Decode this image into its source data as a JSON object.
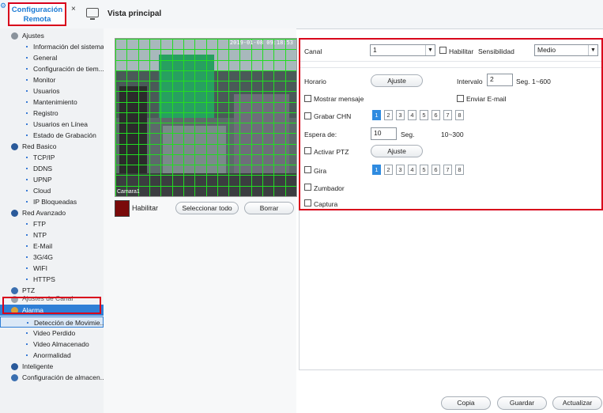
{
  "tabs": {
    "config_label": "Configuración Remota",
    "close_glyph": "×",
    "vista_label": "Vista principal"
  },
  "sidebar": {
    "groups": [
      {
        "label": "Ajustes",
        "icon": "gear-icon"
      },
      {
        "label": "Red Basico",
        "icon": "globe-icon"
      },
      {
        "label": "Red Avanzado",
        "icon": "globe-icon"
      },
      {
        "label": "PTZ",
        "icon": "ptz-icon"
      },
      {
        "label": "Ajustes de Canal",
        "icon": "channel-icon"
      },
      {
        "label": "Alarma",
        "icon": "alarm-icon"
      },
      {
        "label": "Inteligente",
        "icon": "info-icon"
      },
      {
        "label": "Configuración de almacen...",
        "icon": "storage-icon"
      }
    ],
    "ajustes_items": [
      "Información del sistema",
      "General",
      "Configuración de tiem...",
      "Monitor",
      "Usuarios",
      "Mantenimiento",
      "Registro",
      "Usuarios en Línea",
      "Estado de Grabación"
    ],
    "red_basico_items": [
      "TCP/IP",
      "DDNS",
      "UPNP",
      "Cloud",
      "IP Bloqueadas"
    ],
    "red_avanzado_items": [
      "FTP",
      "NTP",
      "E-Mail",
      "3G/4G",
      "WIFI",
      "HTTPS"
    ],
    "alarma_items": [
      "Detección de Movimie...",
      "Video Perdido",
      "Video Almacenado",
      "Anormalidad"
    ]
  },
  "preview": {
    "timestamp": "2019-01-08 09:18:53",
    "camera_name": "Camara1",
    "habilitar_label": "Habilitar",
    "select_all_label": "Seleccionar todo",
    "clear_label": "Borrar",
    "swatch_color": "#7a0a0a",
    "grid_color": "#22dd22"
  },
  "settings": {
    "canal_label": "Canal",
    "canal_value": "1",
    "habilitar_label": "Habilitar",
    "sensibilidad_label": "Sensibilidad",
    "sensibilidad_value": "Medio",
    "horario_label": "Horario",
    "ajuste_label": "Ajuste",
    "intervalo_label": "Intervalo",
    "intervalo_value": "2",
    "intervalo_unit": "Seg.",
    "intervalo_range": "1~600",
    "mostrar_mensaje_label": "Mostrar mensaje",
    "enviar_email_label": "Enviar E-mail",
    "grabar_chn_label": "Grabar CHN",
    "channels": [
      "1",
      "2",
      "3",
      "4",
      "5",
      "6",
      "7",
      "8"
    ],
    "espera_label": "Espera de:",
    "espera_value": "10",
    "espera_unit": "Seg.",
    "espera_range": "10~300",
    "activar_ptz_label": "Activar PTZ",
    "ptz_ajuste_label": "Ajuste",
    "gira_label": "Gira",
    "zumbador_label": "Zumbador",
    "captura_label": "Captura"
  },
  "footer": {
    "copia_label": "Copia",
    "guardar_label": "Guardar",
    "actualizar_label": "Actualizar"
  },
  "colors": {
    "highlight_red": "#d8001b",
    "accent_blue": "#2f7fd6"
  }
}
